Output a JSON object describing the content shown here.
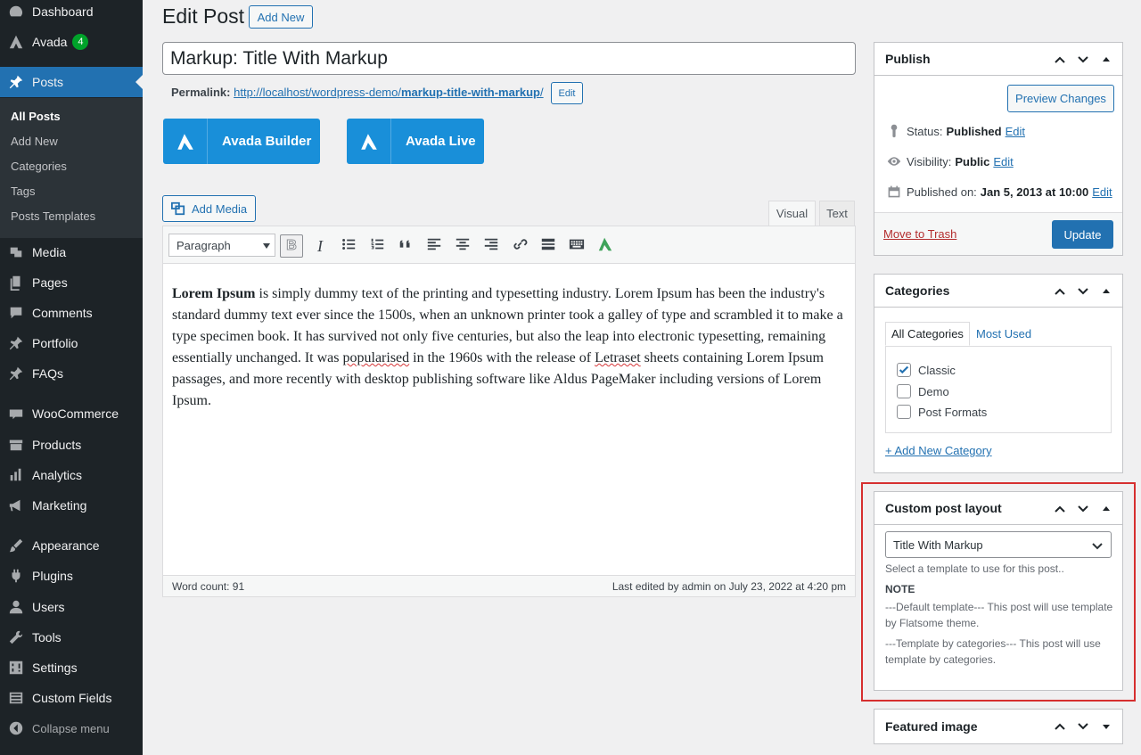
{
  "sidebar": {
    "items": [
      {
        "label": "Dashboard",
        "icon": "dashboard-icon"
      },
      {
        "label": "Avada",
        "icon": "avada-icon",
        "badge": "4"
      },
      {
        "label": "Posts",
        "icon": "pin-icon"
      },
      {
        "label": "Media",
        "icon": "media-icon"
      },
      {
        "label": "Pages",
        "icon": "pages-icon"
      },
      {
        "label": "Comments",
        "icon": "comments-icon"
      },
      {
        "label": "Portfolio",
        "icon": "pin-icon"
      },
      {
        "label": "FAQs",
        "icon": "pin-icon"
      },
      {
        "label": "WooCommerce",
        "icon": "woocommerce-icon"
      },
      {
        "label": "Products",
        "icon": "products-icon"
      },
      {
        "label": "Analytics",
        "icon": "analytics-icon"
      },
      {
        "label": "Marketing",
        "icon": "megaphone-icon"
      },
      {
        "label": "Appearance",
        "icon": "brush-icon"
      },
      {
        "label": "Plugins",
        "icon": "plugin-icon"
      },
      {
        "label": "Users",
        "icon": "users-icon"
      },
      {
        "label": "Tools",
        "icon": "wrench-icon"
      },
      {
        "label": "Settings",
        "icon": "settings-icon"
      },
      {
        "label": "Custom Fields",
        "icon": "custom-fields-icon"
      }
    ],
    "submenu": [
      "All Posts",
      "Add New",
      "Categories",
      "Tags",
      "Posts Templates"
    ],
    "collapse_label": "Collapse menu"
  },
  "header": {
    "title": "Edit Post",
    "add_new_label": "Add New"
  },
  "post": {
    "title": "Markup: Title With Markup",
    "permalink_label": "Permalink:",
    "permalink_base": "http://localhost/wordpress-demo/",
    "permalink_slug": "markup-title-with-markup",
    "permalink_trailing": "/",
    "permalink_edit": "Edit"
  },
  "avada": {
    "builder_label": "Avada Builder",
    "live_label": "Avada Live"
  },
  "editor": {
    "add_media_label": "Add Media",
    "tab_visual": "Visual",
    "tab_text": "Text",
    "format_value": "Paragraph",
    "content": {
      "bold": "Lorem Ipsum",
      "p1": " is simply dummy text of the printing and typesetting industry. Lorem Ipsum has been the industry's standard dummy text ever since the 1500s, when an unknown printer took a galley of type and scrambled it to make a type specimen book. It has survived not only five centuries, but also the leap into electronic typesetting, remaining essentially unchanged. It was ",
      "spell1": "popularised",
      "p2": " in the 1960s with the release of ",
      "spell2": "Letraset",
      "p3": " sheets containing Lorem Ipsum passages, and more recently with desktop publishing software like Aldus PageMaker including versions of Lorem Ipsum."
    },
    "word_count": "Word count: 91",
    "last_edited": "Last edited by admin on July 23, 2022 at 4:20 pm"
  },
  "publish": {
    "title": "Publish",
    "preview_label": "Preview Changes",
    "status_label": "Status:",
    "status_value": "Published",
    "visibility_label": "Visibility:",
    "visibility_value": "Public",
    "published_label": "Published on:",
    "published_value": "Jan 5, 2013 at 10:00",
    "edit_label": "Edit",
    "trash_label": "Move to Trash",
    "update_label": "Update"
  },
  "categories": {
    "title": "Categories",
    "tab_all": "All Categories",
    "tab_most": "Most Used",
    "items": [
      {
        "label": "Classic",
        "checked": true
      },
      {
        "label": "Demo",
        "checked": false
      },
      {
        "label": "Post Formats",
        "checked": false
      }
    ],
    "add_label": "+ Add New Category"
  },
  "layout": {
    "title": "Custom post layout",
    "selected": "Title With Markup",
    "help": "Select a template to use for this post..",
    "note_label": "NOTE",
    "note_default": "---Default template--- This post will use template by Flatsome theme.",
    "note_categories": "---Template by categories--- This post will use template by categories."
  },
  "featured": {
    "title": "Featured image"
  },
  "colors": {
    "sidebar_bg": "#1d2327",
    "accent": "#2271b1",
    "avada_blue": "#198fd9",
    "highlight": "#d62f2f",
    "badge": "#00a32a"
  }
}
